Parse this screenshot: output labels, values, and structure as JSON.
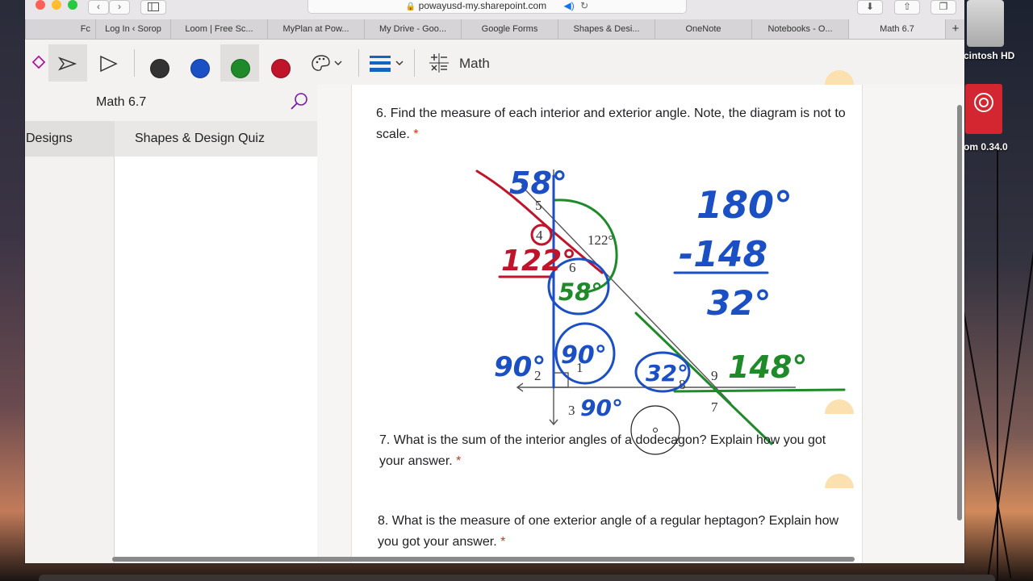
{
  "browser": {
    "url": "powayusd-my.sharepoint.com",
    "tabs": [
      "Fc",
      "Log In ‹ Sorop",
      "Loom | Free Sc...",
      "MyPlan at Pow...",
      "My Drive - Goo...",
      "Google Forms",
      "Shapes & Desi...",
      "OneNote",
      "Notebooks - O...",
      "Math 6.7"
    ],
    "new_tab": "+"
  },
  "toolbar": {
    "pens": [
      {
        "name": "black",
        "color": "#333333"
      },
      {
        "name": "blue",
        "color": "#1b4fc4"
      },
      {
        "name": "green",
        "color": "#1f8a2a"
      },
      {
        "name": "red",
        "color": "#c0142b"
      }
    ],
    "math_label": "Math"
  },
  "notebook": {
    "title": "Math 6.7",
    "section": "Designs",
    "page": "Shapes & Design Quiz"
  },
  "questions": {
    "q6": "6. Find the measure of each interior and exterior angle. Note, the diagram is not to scale.",
    "q7": "7. What is the sum of the interior angles of a dodecagon? Explain how you got your answer.",
    "q8": "8. What is the measure of one exterior angle of a regular heptagon? Explain how you got your answer.",
    "required_mark": "*"
  },
  "diagram": {
    "printed": {
      "angle_label": "122°",
      "numbers": [
        "5",
        "4",
        "6",
        "1",
        "2",
        "3",
        "8",
        "9",
        "7"
      ]
    },
    "annotations": {
      "angle_5": "58°",
      "angle_4": "122°",
      "angle_6": "58°",
      "angle_1": "90°",
      "angle_2": "90°",
      "angle_3": "90°",
      "angle_8": "32°",
      "angle_9": "148°",
      "calc_top": "180°",
      "calc_sub": "-148",
      "calc_result": "32°"
    }
  },
  "desktop": {
    "disk_label": "cintosh HD",
    "app_label": "om 0.34.0"
  }
}
